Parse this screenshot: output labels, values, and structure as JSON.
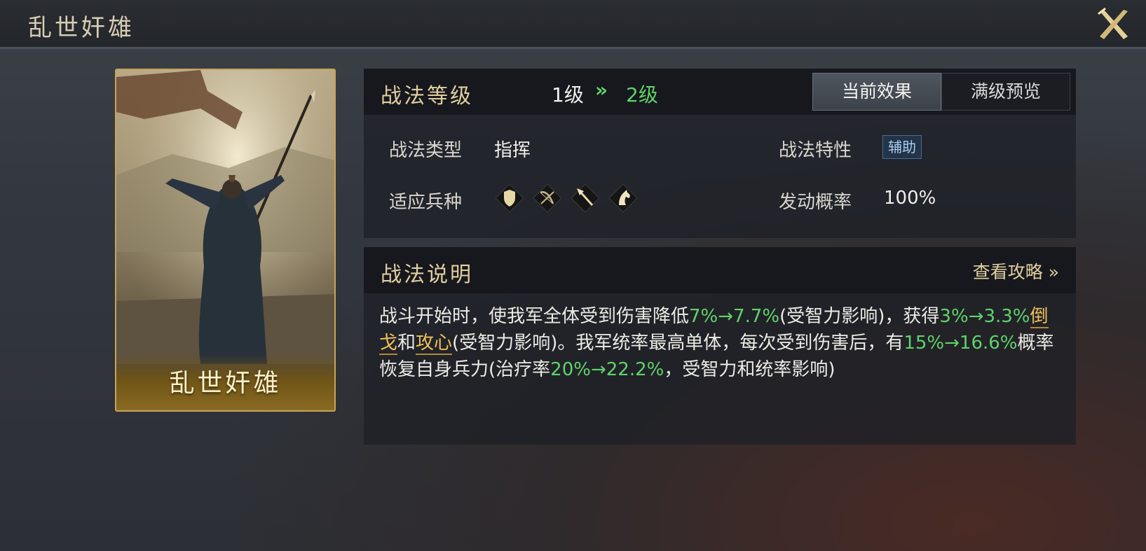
{
  "header": {
    "title": "乱世奸雄"
  },
  "card": {
    "name": "乱世奸雄"
  },
  "level": {
    "title": "战法等级",
    "current": "1级",
    "arrow": "»",
    "next": "2级",
    "tabs": {
      "current_effect": "当前效果",
      "max_preview": "满级预览"
    }
  },
  "info": {
    "type_label": "战法类型",
    "type_value": "指挥",
    "trait_label": "战法特性",
    "trait_badge": "辅助",
    "units_label": "适应兵种",
    "units": [
      "shield-icon",
      "bow-icon",
      "spear-icon",
      "horse-icon"
    ],
    "prob_label": "发动概率",
    "prob_value": "100%"
  },
  "desc": {
    "title": "战法说明",
    "guide_link": "查看攻略 »",
    "segments": [
      {
        "text": "战斗开始时，使我军全体受到伤害降低",
        "style": "normal"
      },
      {
        "text": "7%→7.7%",
        "style": "green"
      },
      {
        "text": "(受智力影响)，获得",
        "style": "normal"
      },
      {
        "text": "3%→3.3%",
        "style": "green"
      },
      {
        "text": "倒戈",
        "style": "gold"
      },
      {
        "text": "和",
        "style": "normal"
      },
      {
        "text": "攻心",
        "style": "gold"
      },
      {
        "text": "(受智力影响)。我军统率最高单体，每次受到伤害后，有",
        "style": "normal"
      },
      {
        "text": "15%→16.6%",
        "style": "green"
      },
      {
        "text": "概率恢复自身兵力(治疗率",
        "style": "normal"
      },
      {
        "text": "20%→22.2%",
        "style": "green"
      },
      {
        "text": "，受智力和统率影响)",
        "style": "normal"
      }
    ]
  },
  "colors": {
    "gold_title": "#e2cfa0",
    "green": "#5fd36a",
    "highlight_gold": "#f0c15a",
    "badge_bg": "#233448"
  }
}
